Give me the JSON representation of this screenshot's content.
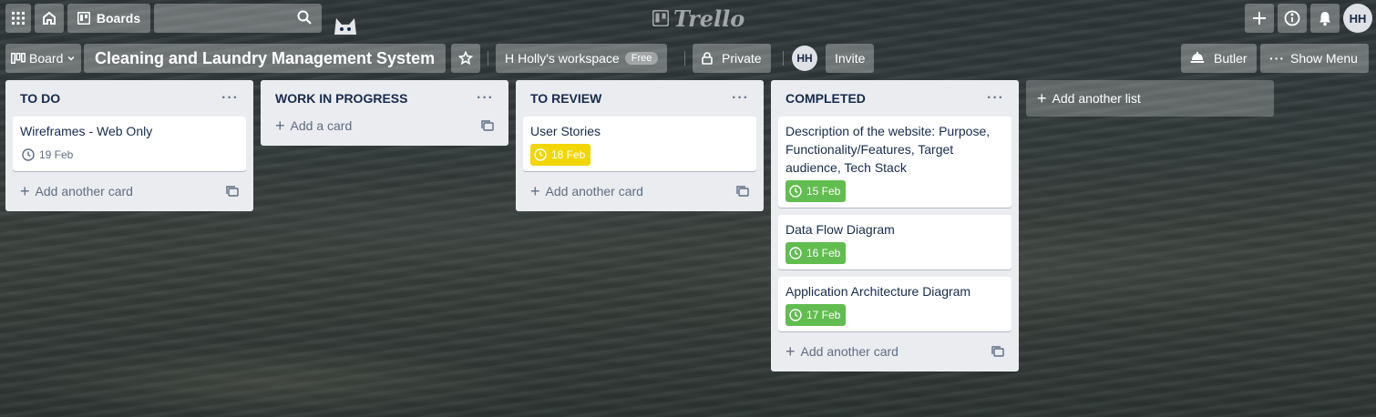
{
  "header": {
    "apps_icon": "grid-icon",
    "home_icon": "home-icon",
    "boards_label": "Boards",
    "search": {
      "value": "",
      "placeholder": ""
    },
    "logo_text": "Trello",
    "avatar_initials": "HH"
  },
  "board": {
    "view_label": "Board",
    "title": "Cleaning and Laundry Management System",
    "workspace_prefix": "H",
    "workspace_label": "Holly's workspace",
    "workspace_badge": "Free",
    "visibility_label": "Private",
    "member_initials": "HH",
    "invite_label": "Invite",
    "butler_label": "Butler",
    "menu_label": "Show Menu"
  },
  "lists": [
    {
      "title": "TO DO",
      "cards": [
        {
          "title": "Wireframes - Web Only",
          "due": "19 Feb"
        }
      ],
      "add_label": "Add another card"
    },
    {
      "title": "WORK IN PROGRESS",
      "cards": [],
      "add_label": "Add a card"
    },
    {
      "title": "TO REVIEW",
      "cards": [
        {
          "title": "User Stories",
          "due": "18 Feb"
        }
      ],
      "add_label": "Add another card"
    },
    {
      "title": "COMPLETED",
      "cards": [
        {
          "title": "Description of the website: Purpose, Functionality/Features, Target audience, Tech Stack",
          "due": "15 Feb"
        },
        {
          "title": "Data Flow Diagram",
          "due": "16 Feb"
        },
        {
          "title": "Application Architecture Diagram",
          "due": "17 Feb"
        }
      ],
      "add_label": "Add another card"
    }
  ],
  "add_list_label": "Add another list",
  "colors": {
    "due_soon": "#f2d600",
    "complete": "#61bd4f",
    "list_bg": "#ebecf0"
  }
}
